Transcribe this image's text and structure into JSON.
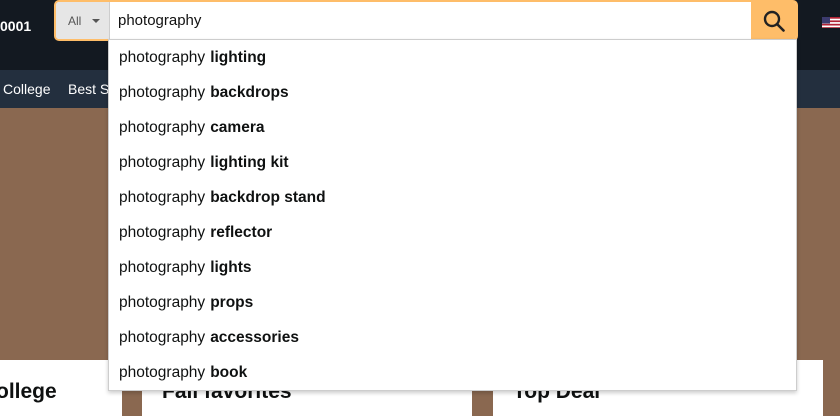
{
  "header": {
    "zip_fragment": "0001",
    "search": {
      "category": "All",
      "query": "photography"
    },
    "icons": {
      "search": "search-icon",
      "flag": "us-flag-icon"
    }
  },
  "nav": {
    "items": [
      {
        "label": "College"
      },
      {
        "label": "Best Se"
      }
    ]
  },
  "cards": [
    {
      "title": "ollege"
    },
    {
      "title": "Fall favorites"
    },
    {
      "title": "Top Deal"
    }
  ],
  "suggestions": [
    {
      "prefix": "photography",
      "completion": "lighting"
    },
    {
      "prefix": "photography",
      "completion": "backdrops"
    },
    {
      "prefix": "photography",
      "completion": "camera"
    },
    {
      "prefix": "photography",
      "completion": "lighting kit"
    },
    {
      "prefix": "photography",
      "completion": "backdrop stand"
    },
    {
      "prefix": "photography",
      "completion": "reflector"
    },
    {
      "prefix": "photography",
      "completion": "lights"
    },
    {
      "prefix": "photography",
      "completion": "props"
    },
    {
      "prefix": "photography",
      "completion": "accessories"
    },
    {
      "prefix": "photography",
      "completion": "book"
    }
  ],
  "colors": {
    "header_bg": "#131921",
    "nav_bg": "#232f3e",
    "search_button": "#febd69",
    "hero_bg": "#8a6850"
  }
}
